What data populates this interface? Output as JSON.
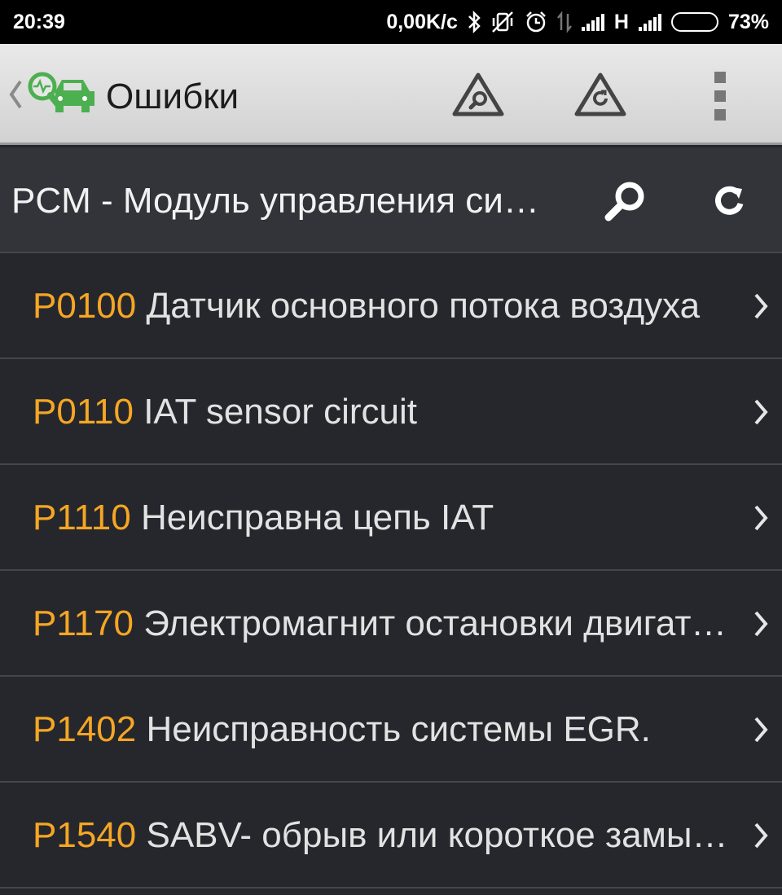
{
  "status_bar": {
    "time": "20:39",
    "network_speed": "0,00K/с",
    "network_type": "H",
    "battery_percent": "73%",
    "battery_level": 0.73,
    "icons": [
      "bluetooth-icon",
      "vibrate-off-icon",
      "alarm-icon",
      "data-arrows-icon",
      "signal-icon",
      "signal-icon-2",
      "battery-icon"
    ]
  },
  "app_bar": {
    "title": "Ошибки",
    "icons": [
      "back-chevron-icon",
      "app-logo-icon",
      "warning-search-icon",
      "warning-refresh-icon",
      "overflow-menu-icon"
    ]
  },
  "module": {
    "title": "PCM - Модуль управления силовым агрегатом",
    "icons": [
      "search-icon",
      "refresh-icon"
    ]
  },
  "errors": [
    {
      "code": "P0100",
      "description": "Датчик основного потока воздуха"
    },
    {
      "code": "P0110",
      "description": "IAT sensor circuit"
    },
    {
      "code": "P1110",
      "description": "Неисправна цепь IAT"
    },
    {
      "code": "P1170",
      "description": "Электромагнит остановки двигателя"
    },
    {
      "code": "P1402",
      "description": "Неисправность системы EGR."
    },
    {
      "code": "P1540",
      "description": "SABV- обрыв или короткое замыкание"
    }
  ],
  "colors": {
    "code": "#f5a623",
    "background": "#26272d",
    "subheader": "#33343a",
    "app_bar": "#dedede",
    "logo_green": "#4caf50"
  }
}
